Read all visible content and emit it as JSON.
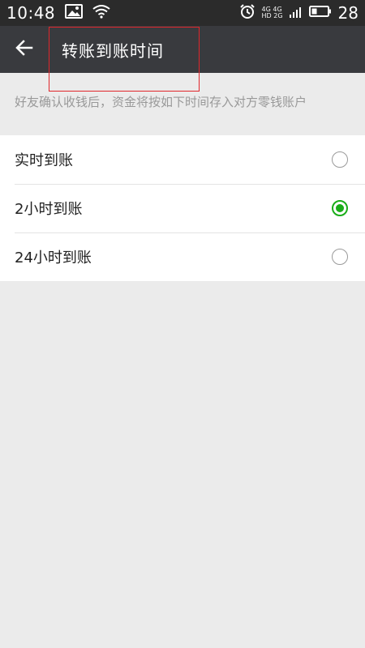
{
  "status_bar": {
    "time": "10:48",
    "battery_level": "28",
    "network_line1": "4G 4G",
    "network_line2": "HD 2G",
    "icons": [
      "image-icon",
      "wifi-icon",
      "alarm-icon",
      "signal-icon",
      "battery-icon"
    ]
  },
  "toolbar": {
    "title": "转账到账时间",
    "back_icon": "arrow-left-icon"
  },
  "description": "好友确认收钱后，资金将按如下时间存入对方零钱账户",
  "options": [
    {
      "label": "实时到账",
      "selected": false
    },
    {
      "label": "2小时到账",
      "selected": true
    },
    {
      "label": "24小时到账",
      "selected": false
    }
  ],
  "colors": {
    "status_bar_bg": "#2b2b2b",
    "toolbar_bg": "#393a3e",
    "page_bg": "#ebebeb",
    "accent_green": "#1aad19",
    "highlight_red": "#e0262b"
  }
}
